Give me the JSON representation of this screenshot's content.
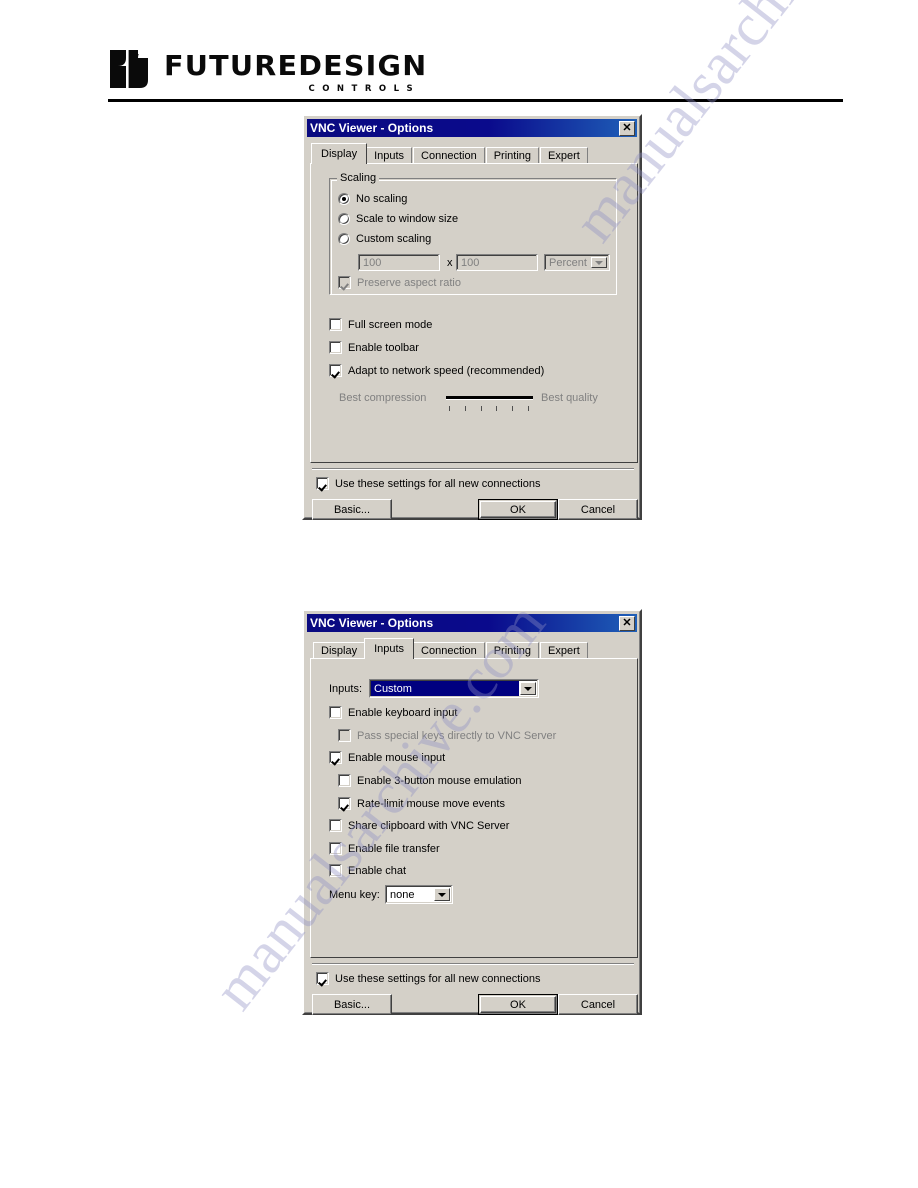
{
  "page": {
    "brand": {
      "name": "FUTUREDESIGN",
      "tagline": "CONTROLS",
      "logo_icon": "futuredesign-logo-mark"
    }
  },
  "colors": {
    "dialog_face": "#d4d0c8",
    "titlebar_start": "#0a0a80",
    "titlebar_end": "#1f60b8",
    "titlebar_text": "#ffffff",
    "selection_blue": "#000080",
    "disabled_text": "#808080"
  },
  "dialogs": [
    {
      "id": "display-dialog",
      "title": "VNC Viewer - Options",
      "close_icon": "close-icon",
      "close_label": "✕",
      "tabs": [
        {
          "label": "Display",
          "selected": true
        },
        {
          "label": "Inputs",
          "selected": false
        },
        {
          "label": "Connection",
          "selected": false
        },
        {
          "label": "Printing",
          "selected": false
        },
        {
          "label": "Expert",
          "selected": false
        }
      ],
      "scaling_group": {
        "title": "Scaling",
        "radios": [
          {
            "label": "No scaling",
            "checked": true
          },
          {
            "label": "Scale to window size",
            "checked": false
          },
          {
            "label": "Custom scaling",
            "checked": false
          }
        ],
        "width_value": "100",
        "separator": "x",
        "height_value": "100",
        "units_value": "Percent",
        "preserve_aspect": {
          "label": "Preserve aspect ratio",
          "checked": true,
          "disabled": true
        }
      },
      "options": [
        {
          "label": "Full screen mode",
          "checked": false
        },
        {
          "label": "Enable toolbar",
          "checked": false
        },
        {
          "label": "Adapt to network speed (recommended)",
          "checked": true
        }
      ],
      "quality_slider": {
        "left_label": "Best compression",
        "right_label": "Best quality",
        "ticks": 6,
        "disabled": true
      },
      "use_for_all": {
        "label": "Use these settings for all new connections",
        "checked": true
      },
      "buttons": {
        "basic": "Basic...",
        "ok": "OK",
        "cancel": "Cancel"
      }
    },
    {
      "id": "inputs-dialog",
      "title": "VNC Viewer - Options",
      "close_icon": "close-icon",
      "close_label": "✕",
      "tabs": [
        {
          "label": "Display",
          "selected": false
        },
        {
          "label": "Inputs",
          "selected": true
        },
        {
          "label": "Connection",
          "selected": false
        },
        {
          "label": "Printing",
          "selected": false
        },
        {
          "label": "Expert",
          "selected": false
        }
      ],
      "inputs_select": {
        "label": "Inputs:",
        "value": "Custom"
      },
      "options": [
        {
          "label": "Enable keyboard input",
          "checked": false,
          "disabled": false,
          "indent": 0
        },
        {
          "label": "Pass special keys directly to VNC Server",
          "checked": false,
          "disabled": true,
          "indent": 1
        },
        {
          "label": "Enable mouse input",
          "checked": true,
          "disabled": false,
          "indent": 0
        },
        {
          "label": "Enable 3-button mouse emulation",
          "checked": false,
          "disabled": false,
          "indent": 1
        },
        {
          "label": "Rate-limit mouse move events",
          "checked": true,
          "disabled": false,
          "indent": 1
        },
        {
          "label": "Share clipboard with VNC Server",
          "checked": false,
          "disabled": false,
          "indent": 0
        },
        {
          "label": "Enable file transfer",
          "checked": false,
          "disabled": false,
          "indent": 0
        },
        {
          "label": "Enable chat",
          "checked": false,
          "disabled": false,
          "indent": 0
        }
      ],
      "menu_key": {
        "label": "Menu key:",
        "value": "none"
      },
      "use_for_all": {
        "label": "Use these settings for all new connections",
        "checked": true
      },
      "buttons": {
        "basic": "Basic...",
        "ok": "OK",
        "cancel": "Cancel"
      }
    }
  ],
  "watermark": {
    "line1": "manualsarchive.com"
  }
}
